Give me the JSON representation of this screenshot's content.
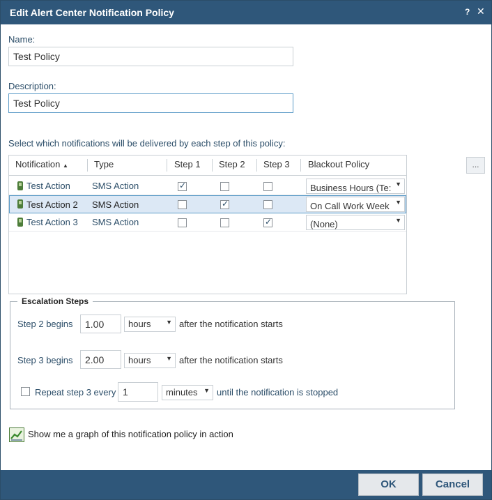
{
  "dialog": {
    "title": "Edit Alert Center Notification Policy",
    "help_glyph": "?",
    "close_glyph": "✕"
  },
  "form": {
    "name_label": "Name:",
    "name_value": "Test Policy",
    "description_label": "Description:",
    "description_value": "Test Policy",
    "instructions": "Select which notifications will be delivered by each step of this policy:"
  },
  "grid": {
    "columns": [
      "Notification",
      "Type",
      "Step 1",
      "Step 2",
      "Step 3",
      "Blackout Policy"
    ],
    "sort_indicator": "▲",
    "rows": [
      {
        "name": "Test Action",
        "type": "SMS Action",
        "step1": true,
        "step2": false,
        "step3": false,
        "blackout": "Business Hours (Te:"
      },
      {
        "name": "Test Action 2",
        "type": "SMS Action",
        "step1": false,
        "step2": true,
        "step3": false,
        "blackout": "On Call Work Week"
      },
      {
        "name": "Test Action 3",
        "type": "SMS Action",
        "step1": false,
        "step2": false,
        "step3": true,
        "blackout": "(None)"
      }
    ],
    "more_button": "..."
  },
  "escalation": {
    "legend": "Escalation Steps",
    "step2_label": "Step 2 begins",
    "step2_value": "1.00",
    "step2_unit": "hours",
    "step2_suffix": "after the notification starts",
    "step3_label": "Step 3 begins",
    "step3_value": "2.00",
    "step3_unit": "hours",
    "step3_suffix": "after the notification starts",
    "repeat_label": "Repeat step 3 every",
    "repeat_value": "1",
    "repeat_unit": "minutes",
    "repeat_suffix": "until the notification is stopped"
  },
  "graph_link": "Show me a graph of this notification policy in action",
  "buttons": {
    "ok": "OK",
    "cancel": "Cancel"
  },
  "colors": {
    "titlebar": "#2f577a",
    "accent": "#5b9bc7"
  }
}
